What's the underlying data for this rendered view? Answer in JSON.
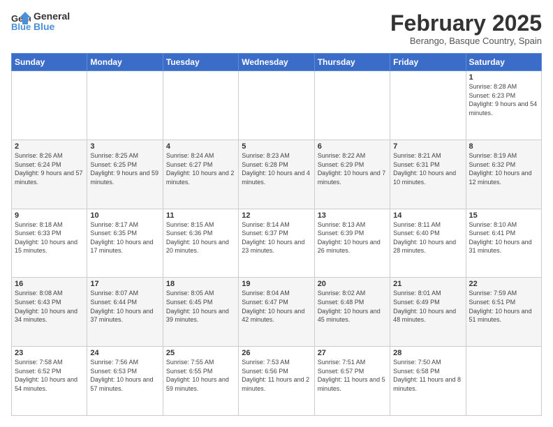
{
  "header": {
    "logo_line1": "General",
    "logo_line2": "Blue",
    "month": "February 2025",
    "location": "Berango, Basque Country, Spain"
  },
  "weekdays": [
    "Sunday",
    "Monday",
    "Tuesday",
    "Wednesday",
    "Thursday",
    "Friday",
    "Saturday"
  ],
  "weeks": [
    [
      {
        "day": "",
        "info": ""
      },
      {
        "day": "",
        "info": ""
      },
      {
        "day": "",
        "info": ""
      },
      {
        "day": "",
        "info": ""
      },
      {
        "day": "",
        "info": ""
      },
      {
        "day": "",
        "info": ""
      },
      {
        "day": "1",
        "info": "Sunrise: 8:28 AM\nSunset: 6:23 PM\nDaylight: 9 hours and 54 minutes."
      }
    ],
    [
      {
        "day": "2",
        "info": "Sunrise: 8:26 AM\nSunset: 6:24 PM\nDaylight: 9 hours and 57 minutes."
      },
      {
        "day": "3",
        "info": "Sunrise: 8:25 AM\nSunset: 6:25 PM\nDaylight: 9 hours and 59 minutes."
      },
      {
        "day": "4",
        "info": "Sunrise: 8:24 AM\nSunset: 6:27 PM\nDaylight: 10 hours and 2 minutes."
      },
      {
        "day": "5",
        "info": "Sunrise: 8:23 AM\nSunset: 6:28 PM\nDaylight: 10 hours and 4 minutes."
      },
      {
        "day": "6",
        "info": "Sunrise: 8:22 AM\nSunset: 6:29 PM\nDaylight: 10 hours and 7 minutes."
      },
      {
        "day": "7",
        "info": "Sunrise: 8:21 AM\nSunset: 6:31 PM\nDaylight: 10 hours and 10 minutes."
      },
      {
        "day": "8",
        "info": "Sunrise: 8:19 AM\nSunset: 6:32 PM\nDaylight: 10 hours and 12 minutes."
      }
    ],
    [
      {
        "day": "9",
        "info": "Sunrise: 8:18 AM\nSunset: 6:33 PM\nDaylight: 10 hours and 15 minutes."
      },
      {
        "day": "10",
        "info": "Sunrise: 8:17 AM\nSunset: 6:35 PM\nDaylight: 10 hours and 17 minutes."
      },
      {
        "day": "11",
        "info": "Sunrise: 8:15 AM\nSunset: 6:36 PM\nDaylight: 10 hours and 20 minutes."
      },
      {
        "day": "12",
        "info": "Sunrise: 8:14 AM\nSunset: 6:37 PM\nDaylight: 10 hours and 23 minutes."
      },
      {
        "day": "13",
        "info": "Sunrise: 8:13 AM\nSunset: 6:39 PM\nDaylight: 10 hours and 26 minutes."
      },
      {
        "day": "14",
        "info": "Sunrise: 8:11 AM\nSunset: 6:40 PM\nDaylight: 10 hours and 28 minutes."
      },
      {
        "day": "15",
        "info": "Sunrise: 8:10 AM\nSunset: 6:41 PM\nDaylight: 10 hours and 31 minutes."
      }
    ],
    [
      {
        "day": "16",
        "info": "Sunrise: 8:08 AM\nSunset: 6:43 PM\nDaylight: 10 hours and 34 minutes."
      },
      {
        "day": "17",
        "info": "Sunrise: 8:07 AM\nSunset: 6:44 PM\nDaylight: 10 hours and 37 minutes."
      },
      {
        "day": "18",
        "info": "Sunrise: 8:05 AM\nSunset: 6:45 PM\nDaylight: 10 hours and 39 minutes."
      },
      {
        "day": "19",
        "info": "Sunrise: 8:04 AM\nSunset: 6:47 PM\nDaylight: 10 hours and 42 minutes."
      },
      {
        "day": "20",
        "info": "Sunrise: 8:02 AM\nSunset: 6:48 PM\nDaylight: 10 hours and 45 minutes."
      },
      {
        "day": "21",
        "info": "Sunrise: 8:01 AM\nSunset: 6:49 PM\nDaylight: 10 hours and 48 minutes."
      },
      {
        "day": "22",
        "info": "Sunrise: 7:59 AM\nSunset: 6:51 PM\nDaylight: 10 hours and 51 minutes."
      }
    ],
    [
      {
        "day": "23",
        "info": "Sunrise: 7:58 AM\nSunset: 6:52 PM\nDaylight: 10 hours and 54 minutes."
      },
      {
        "day": "24",
        "info": "Sunrise: 7:56 AM\nSunset: 6:53 PM\nDaylight: 10 hours and 57 minutes."
      },
      {
        "day": "25",
        "info": "Sunrise: 7:55 AM\nSunset: 6:55 PM\nDaylight: 10 hours and 59 minutes."
      },
      {
        "day": "26",
        "info": "Sunrise: 7:53 AM\nSunset: 6:56 PM\nDaylight: 11 hours and 2 minutes."
      },
      {
        "day": "27",
        "info": "Sunrise: 7:51 AM\nSunset: 6:57 PM\nDaylight: 11 hours and 5 minutes."
      },
      {
        "day": "28",
        "info": "Sunrise: 7:50 AM\nSunset: 6:58 PM\nDaylight: 11 hours and 8 minutes."
      },
      {
        "day": "",
        "info": ""
      }
    ]
  ]
}
